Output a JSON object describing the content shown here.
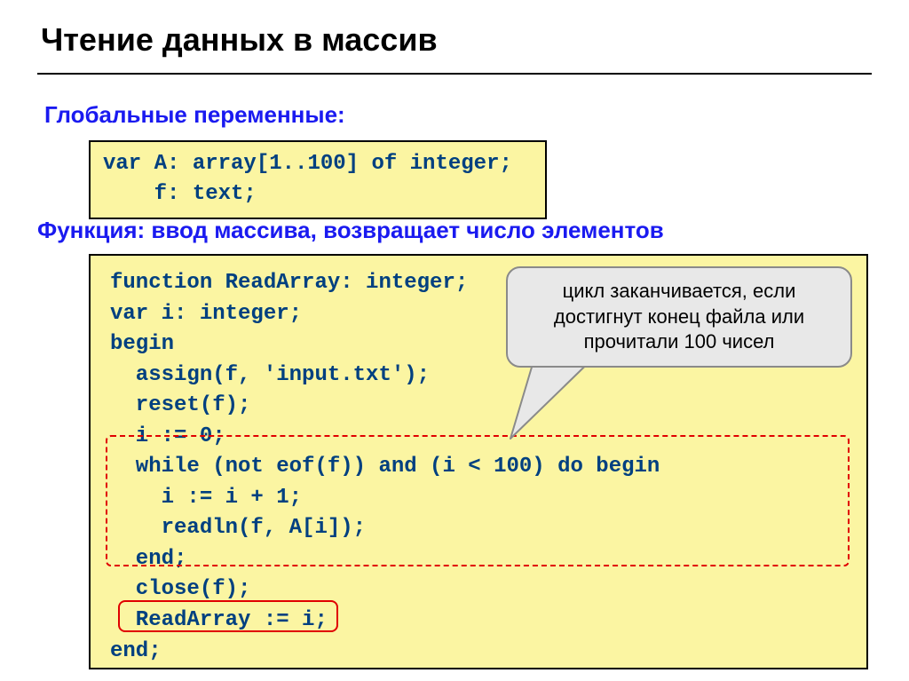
{
  "title": "Чтение данных в массив",
  "sub1": "Глобальные переменные:",
  "code1": "var A: array[1..100] of integer;\n    f: text;",
  "sub2": "Функция: ввод массива, возвращает число элементов",
  "code2": "function ReadArray: integer;\nvar i: integer;\nbegin\n  assign(f, 'input.txt');\n  reset(f);\n  i := 0;\n  while (not eof(f)) and (i < 100) do begin\n    i := i + 1;\n    readln(f, A[i]);\n  end;\n  close(f);\n  ReadArray := i;\nend;",
  "callout": "цикл заканчивается, если достигнут конец файла или прочитали 100 чисел"
}
